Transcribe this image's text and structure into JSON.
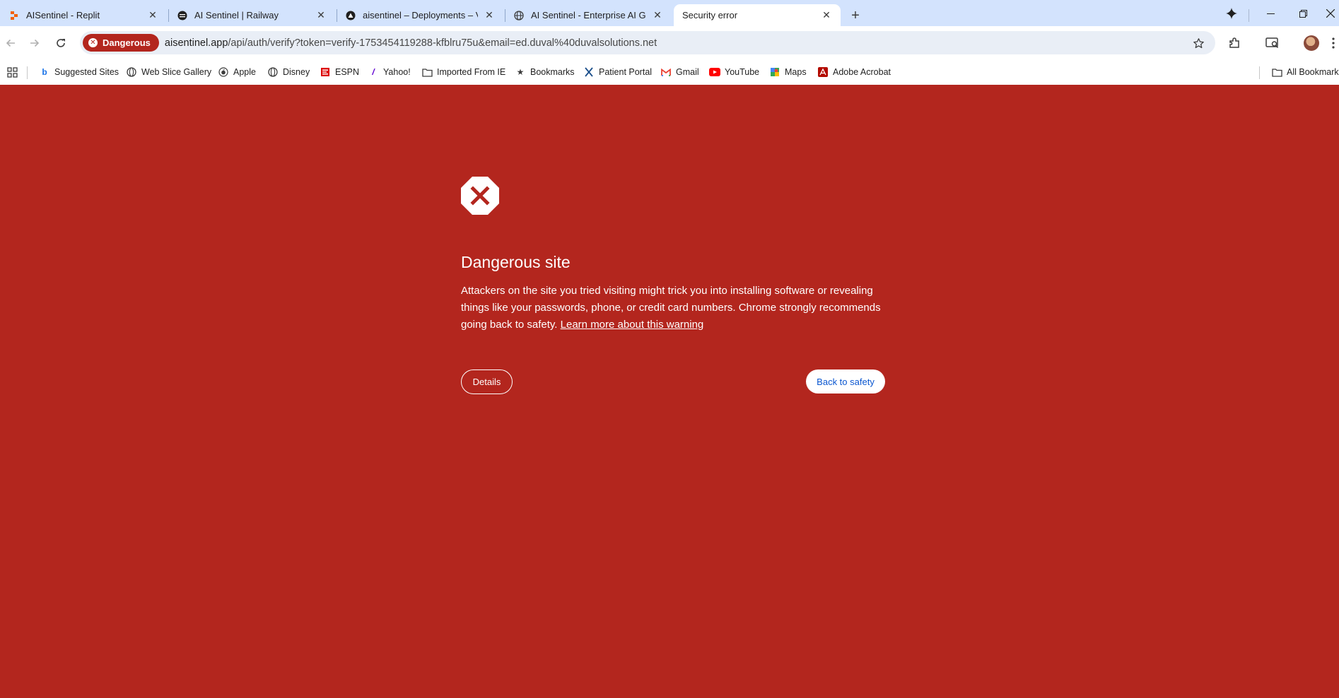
{
  "tabs": [
    {
      "title": "AISentinel - Replit",
      "favicon": "replit-icon",
      "active": false
    },
    {
      "title": "AI Sentinel | Railway",
      "favicon": "railway-icon",
      "active": false
    },
    {
      "title": "aisentinel – Deployments – Verc",
      "favicon": "vercel-icon",
      "active": false
    },
    {
      "title": "AI Sentinel - Enterprise AI Gove",
      "favicon": "globe-icon",
      "active": false
    },
    {
      "title": "Security error",
      "favicon": "",
      "active": true
    }
  ],
  "omnibox": {
    "badge": "Dangerous",
    "url_host": "aisentinel.app",
    "url_path": "/api/auth/verify?token=verify-1753454119288-kfblru75u&email=ed.duval%40duvalsolutions.net"
  },
  "bookmarks": [
    {
      "label": "Suggested Sites",
      "icon": "bing-icon"
    },
    {
      "label": "Web Slice Gallery",
      "icon": "globe-icon"
    },
    {
      "label": "Apple",
      "icon": "apple-icon"
    },
    {
      "label": "Disney",
      "icon": "globe-icon"
    },
    {
      "label": "ESPN",
      "icon": "espn-icon"
    },
    {
      "label": "Yahoo!",
      "icon": "yahoo-icon"
    },
    {
      "label": "Imported From IE",
      "icon": "folder-icon"
    },
    {
      "label": "Bookmarks",
      "icon": "star-icon"
    },
    {
      "label": "Patient Portal",
      "icon": "x-logo-icon"
    },
    {
      "label": "Gmail",
      "icon": "gmail-icon"
    },
    {
      "label": "YouTube",
      "icon": "youtube-icon"
    },
    {
      "label": "Maps",
      "icon": "maps-icon"
    },
    {
      "label": "Adobe Acrobat",
      "icon": "acrobat-icon"
    }
  ],
  "all_bookmarks_label": "All Bookmarks",
  "interstitial": {
    "heading": "Dangerous site",
    "body": "Attackers on the site you tried visiting might trick you into installing software or revealing things like your passwords, phone, or credit card numbers. Chrome strongly recommends going back to safety.",
    "learn_more": "Learn more about this warning",
    "details_button": "Details",
    "back_button": "Back to safety"
  },
  "colors": {
    "danger_background": "#b3261e",
    "tabstrip": "#d3e3fd",
    "link_blue": "#0b57d0"
  }
}
